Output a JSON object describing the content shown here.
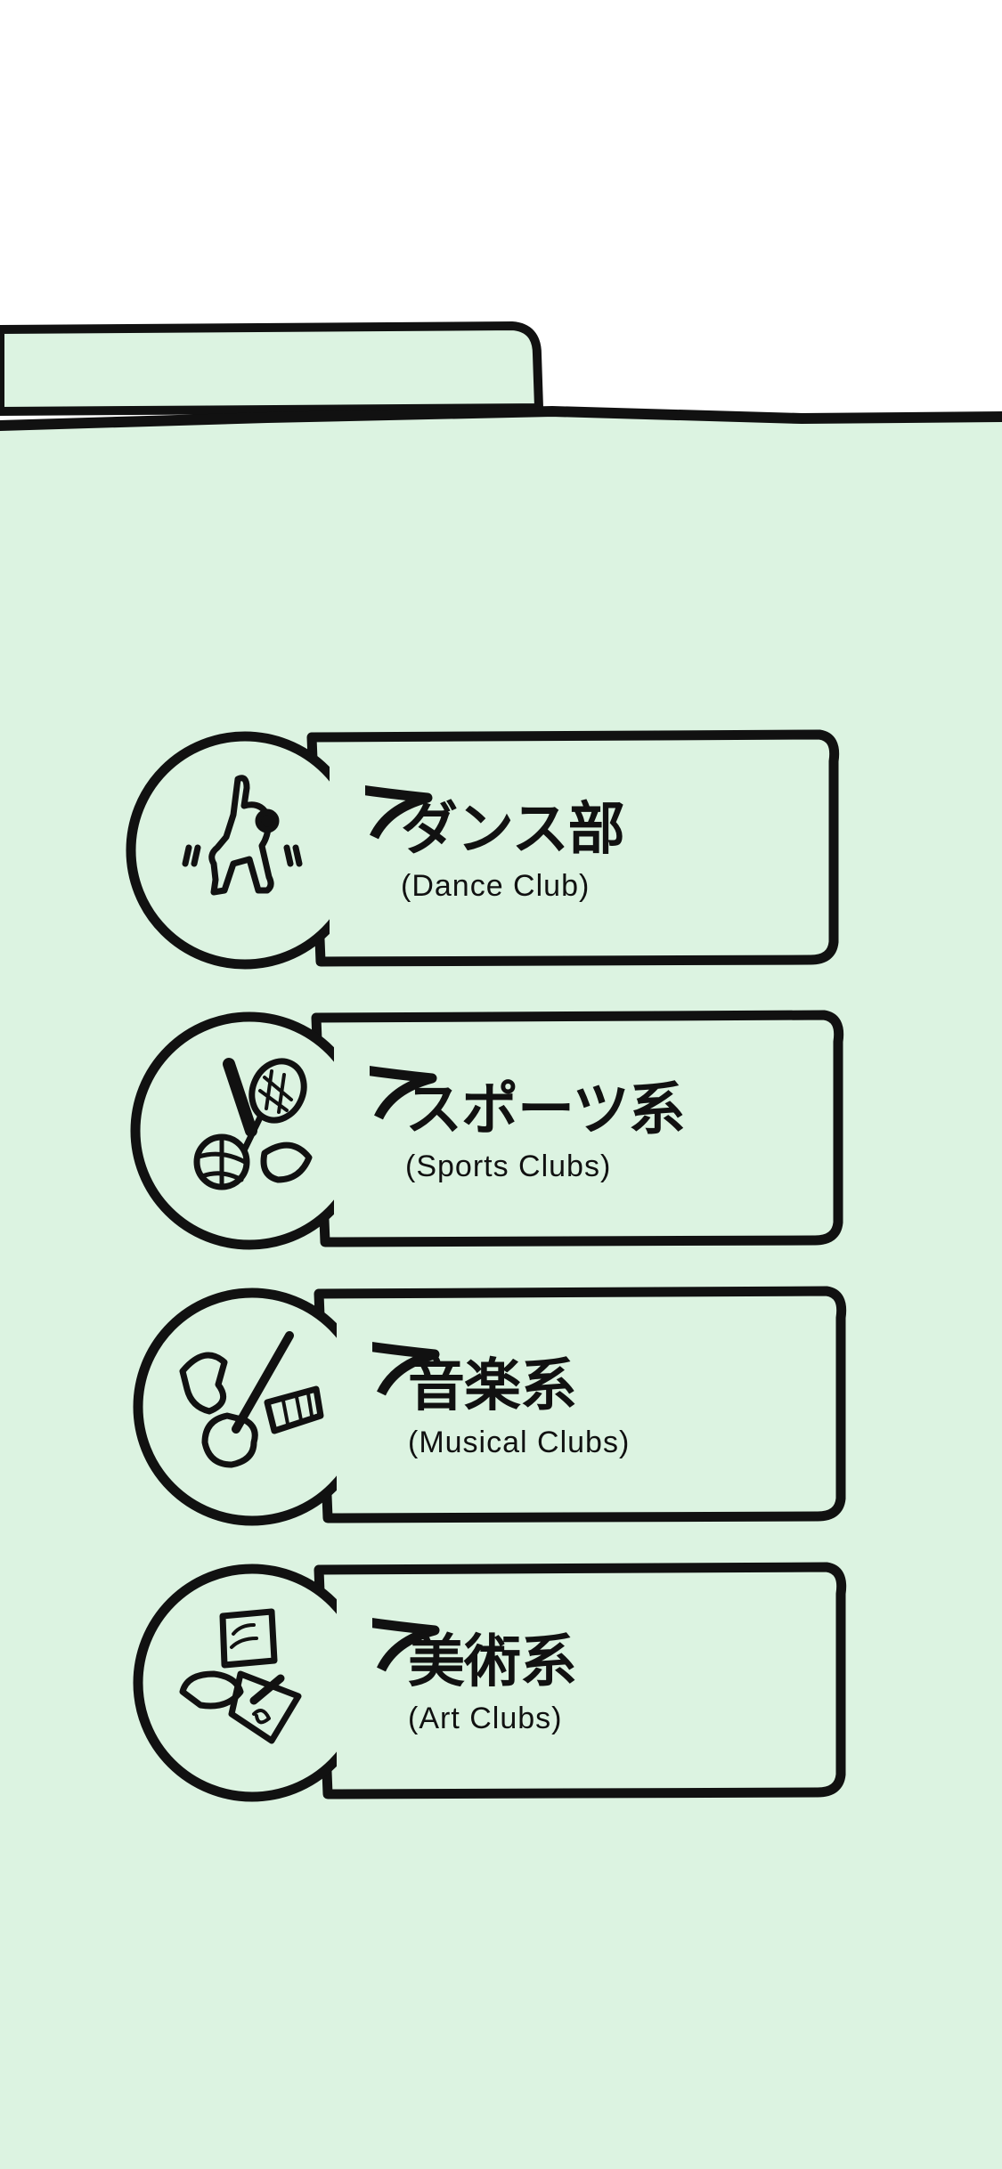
{
  "colors": {
    "panel": "#dcf3e1",
    "stroke": "#111111",
    "background": "#ffffff"
  },
  "clubs": [
    {
      "title": "ダンス部",
      "subtitle": "(Dance Club)",
      "icon": "dancer-icon"
    },
    {
      "title": "スポーツ系",
      "subtitle": "(Sports Clubs)",
      "icon": "sports-equipment-icon"
    },
    {
      "title": "音楽系",
      "subtitle": "(Musical Clubs)",
      "icon": "instruments-icon"
    },
    {
      "title": "美術系",
      "subtitle": "(Art Clubs)",
      "icon": "art-supplies-icon"
    }
  ]
}
